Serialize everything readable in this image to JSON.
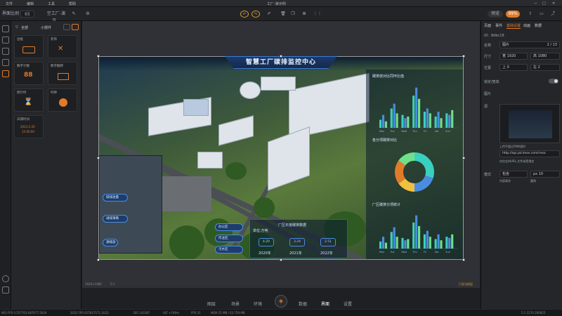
{
  "menu": [
    "文件",
    "编辑",
    "工具",
    "帮助"
  ],
  "window_title": "工厂-演示例",
  "toolbar": {
    "zoom_label": "界面比例",
    "zoom_value": "65",
    "doc_name": "空工厂-演示...",
    "preview": "预览",
    "badge": "99%"
  },
  "left_panel": {
    "tab_all": "全部",
    "tab_widgets": "小部件",
    "components": [
      {
        "label": "边框",
        "icon": "frame-icon"
      },
      {
        "label": "装饰",
        "icon": "decor-icon"
      },
      {
        "label": "数字计数",
        "icon": "counter-icon"
      },
      {
        "label": "数字翻牌",
        "icon": "flip-icon"
      },
      {
        "label": "倒计时",
        "icon": "hourglass-icon"
      },
      {
        "label": "时钟",
        "icon": "clock-icon"
      },
      {
        "label": "日期时间",
        "icon": "datetime-icon"
      }
    ],
    "datetime_preview": [
      "2023-2-20",
      "13:00:00"
    ]
  },
  "scene": {
    "title": "智慧工厂碳排监控中心",
    "chart1_title": "碳排放对比同环比值",
    "chart2_title": "各分项碳排对比",
    "chart3_title": "厂区碳排分项统计",
    "btn_carbon": "碳排放量",
    "btn_reduce": "减排策略",
    "btn_source": "源排放",
    "btn_office": "办公区",
    "btn_work": "作业区",
    "btn_water": "污水区",
    "table_title": "厂区年度碳排数据",
    "unit": "单位:万吨",
    "years": [
      {
        "value": "4.20",
        "label": "2020年"
      },
      {
        "value": "3.24",
        "label": "2021年"
      },
      {
        "value": "2.51",
        "label": "2022年"
      }
    ]
  },
  "canvas_footer": {
    "size_info": "1920×1080",
    "zoom_info": "5:1",
    "right_link": "只显当前层"
  },
  "bottom_nav": [
    "图层",
    "场景",
    "环境",
    "数据",
    "界面",
    "设置"
  ],
  "bottom_nav_active": "界面",
  "right_panel": {
    "tabs": [
      "页面",
      "事件",
      "基础设置",
      "动画",
      "数据"
    ],
    "active_tab": "基础设置",
    "id_label": "ID:",
    "id_value": "8dbc18",
    "name_label": "名称",
    "name_value": "图片",
    "name_count": "2 / 13",
    "size_label": "尺寸",
    "width": "宽 1920",
    "height": "高 1080",
    "pos_label": "位置",
    "pos_x": "上 0",
    "pos_y": "左 2",
    "lock_label": "锁定/宽高",
    "section_image": "图片",
    "image_sub": "源",
    "upload_hint": "上传不超过5M的图片",
    "url_value": "http://api.picimos.com/reso",
    "url_hint": "仅仅支持URL,文件或是指定",
    "fit_label": "模式",
    "fit_value": "包含",
    "opacity_value": "px 10",
    "fit_sub": "内容填充",
    "opacity_sub": "圆角"
  },
  "status": {
    "left": "963 FPS  0.557703.087677.5634",
    "mid1": "2032 FPS  637837571,3U23",
    "mid2": "DIS 143387",
    "mid3": "ALT +190m",
    "mid4": "FPS 31",
    "mid5": "MEM 25 MB / 63.759 MB",
    "right": "5.2.1570.200825"
  },
  "chart_data": [
    {
      "type": "bar",
      "categories": [
        "Mon",
        "Tue",
        "Wed",
        "Thu",
        "Fri",
        "Sat",
        "Sun"
      ],
      "series": [
        {
          "values": [
            5,
            12,
            8,
            20,
            10,
            7,
            9
          ]
        },
        {
          "values": [
            8,
            15,
            6,
            25,
            12,
            10,
            8
          ]
        },
        {
          "values": [
            4,
            9,
            7,
            18,
            9,
            6,
            11
          ]
        }
      ]
    },
    {
      "type": "pie",
      "values": [
        30,
        20,
        15,
        20,
        15
      ]
    },
    {
      "type": "bar",
      "categories": [
        "Mon",
        "Tue",
        "Wed",
        "Thu",
        "Fri",
        "Sat",
        "Sun"
      ],
      "series": [
        {
          "values": [
            6,
            14,
            9,
            22,
            12,
            8,
            10
          ]
        },
        {
          "values": [
            10,
            18,
            7,
            28,
            15,
            12,
            9
          ]
        },
        {
          "values": [
            5,
            10,
            8,
            19,
            10,
            7,
            12
          ]
        }
      ]
    }
  ],
  "colors": {
    "accent": "#4a8de0",
    "bar1": "#3ad0c0",
    "bar2": "#4a8de0",
    "bar3": "#6fe08a",
    "brand": "#e07b2a"
  }
}
